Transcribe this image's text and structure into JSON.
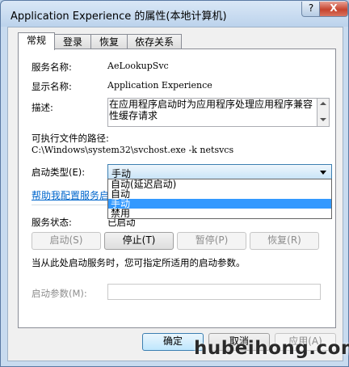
{
  "window": {
    "title": "Application Experience 的属性(本地计算机)",
    "help_label": "?",
    "close_label": "X"
  },
  "tabs": [
    {
      "label": "常规",
      "active": true
    },
    {
      "label": "登录",
      "active": false
    },
    {
      "label": "恢复",
      "active": false
    },
    {
      "label": "依存关系",
      "active": false
    }
  ],
  "general": {
    "service_name_label": "服务名称:",
    "service_name_value": "AeLookupSvc",
    "display_name_label": "显示名称:",
    "display_name_value": "Application Experience",
    "description_label": "描述:",
    "description_value": "在应用程序启动时为应用程序处理应用程序兼容性缓存请求",
    "exe_path_label": "可执行文件的路径:",
    "exe_path_value": "C:\\Windows\\system32\\svchost.exe -k netsvcs",
    "startup_type_label": "启动类型(E):",
    "startup_type_value": "手动",
    "startup_options": [
      "自动(延迟启动)",
      "自动",
      "手动",
      "禁用"
    ],
    "startup_selected_index": 2,
    "help_link": "帮助我配置服务启",
    "status_label": "服务状态:",
    "status_value": "已启动",
    "start_note": "当从此处启动服务时，您可指定所适用的启动参数。",
    "params_label": "启动参数(M):",
    "params_value": ""
  },
  "service_buttons": [
    {
      "label": "启动(S)",
      "enabled": false
    },
    {
      "label": "停止(T)",
      "enabled": true
    },
    {
      "label": "暂停(P)",
      "enabled": false
    },
    {
      "label": "恢复(R)",
      "enabled": false
    }
  ],
  "dialog_buttons": {
    "ok": "确定",
    "cancel": "取消",
    "apply": "应用(A)"
  },
  "watermark": "hubeihong.com"
}
